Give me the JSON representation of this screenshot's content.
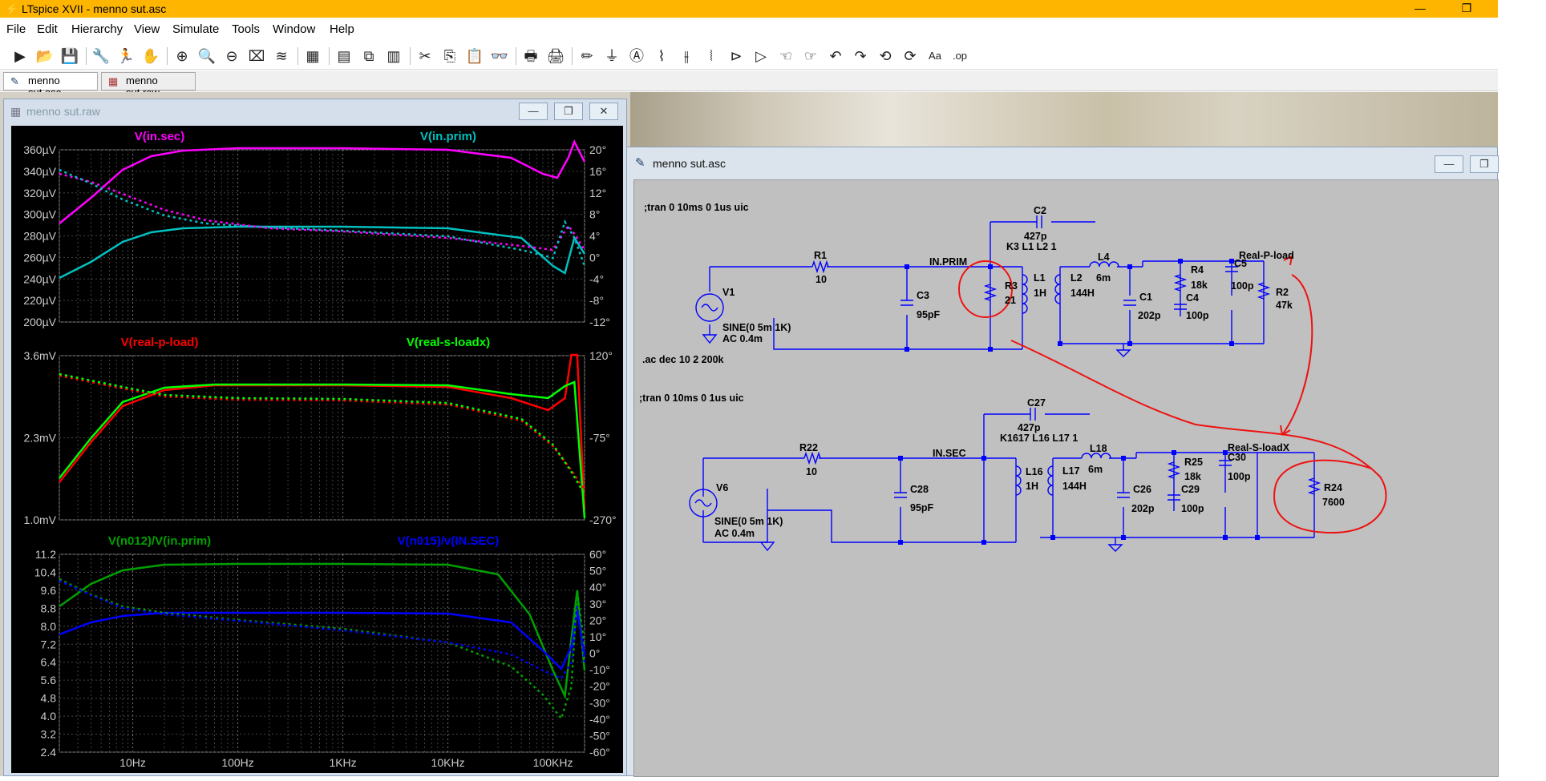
{
  "window": {
    "title": "LTspice XVII - menno sut.asc",
    "icon": "ltspice-icon",
    "controls": [
      "minimize",
      "restore"
    ]
  },
  "menu": [
    "File",
    "Edit",
    "Hierarchy",
    "View",
    "Simulate",
    "Tools",
    "Window",
    "Help"
  ],
  "toolbar_icons": [
    "run-icon",
    "open-icon",
    "save-icon",
    "settings-icon",
    "run-sim-icon",
    "pan-hand-icon",
    "zoom-in-icon",
    "zoom-area-icon",
    "zoom-out-icon",
    "zoom-fit-icon",
    "autoscale-icon",
    "grid-icon",
    "tile-horizontal-icon",
    "cascade-icon",
    "tile-vertical-icon",
    "cut-icon",
    "copy-icon",
    "paste-icon",
    "find-icon",
    "print-icon",
    "print-setup-icon",
    "draw-wire-icon",
    "ground-icon",
    "label-net-icon",
    "resistor-icon",
    "capacitor-icon",
    "inductor-icon",
    "diode-icon",
    "component-icon",
    "move-icon",
    "drag-icon",
    "undo-icon",
    "redo-icon",
    "rotate-icon",
    "mirror-icon",
    "text-icon",
    "spice-directive-icon"
  ],
  "tabs": [
    {
      "label": "menno sut.asc",
      "icon": "schematic-icon",
      "active": true
    },
    {
      "label": "menno sut.raw",
      "icon": "waveform-icon",
      "active": false
    }
  ],
  "plot_window": {
    "title": "menno sut.raw",
    "panes": [
      {
        "traces": [
          {
            "label": "V(in.sec)",
            "color": "#ff00ff"
          },
          {
            "label": "V(in.prim)",
            "color": "#00c0c0"
          }
        ],
        "left_ticks": [
          "360µV",
          "340µV",
          "320µV",
          "300µV",
          "280µV",
          "260µV",
          "240µV",
          "220µV",
          "200µV"
        ],
        "right_ticks": [
          "20°",
          "16°",
          "12°",
          "8°",
          "4°",
          "0°",
          "-4°",
          "-8°",
          "-12°"
        ]
      },
      {
        "traces": [
          {
            "label": "V(real-p-load)",
            "color": "#ff0000"
          },
          {
            "label": "V(real-s-loadx)",
            "color": "#00ff00"
          }
        ],
        "left_ticks": [
          "3.6mV",
          "2.3mV",
          "1.0mV"
        ],
        "right_ticks": [
          "120°",
          "-75°",
          "-270°"
        ]
      },
      {
        "traces": [
          {
            "label": "V(n012)/V(in.prim)",
            "color": "#00a000"
          },
          {
            "label": "V(n015)/v(IN.SEC)",
            "color": "#0000ff"
          }
        ],
        "left_ticks": [
          "11.2",
          "10.4",
          "9.6",
          "8.8",
          "8.0",
          "7.2",
          "6.4",
          "5.6",
          "4.8",
          "4.0",
          "3.2",
          "2.4"
        ],
        "right_ticks": [
          "60°",
          "50°",
          "40°",
          "30°",
          "20°",
          "10°",
          "0°",
          "-10°",
          "-20°",
          "-30°",
          "-40°",
          "-50°",
          "-60°"
        ]
      }
    ],
    "x_ticks": [
      "10Hz",
      "100Hz",
      "1KHz",
      "10KHz",
      "100KHz"
    ]
  },
  "schematic_window": {
    "title": "menno sut.asc",
    "directives": [
      ";tran 0 10ms 0 1us uic",
      ".ac dec 10 2 200k",
      ";tran 0 10ms 0 1us uic"
    ],
    "circuit_top": {
      "source": {
        "name": "V1",
        "value1": "SINE(0 5m 1K)",
        "value2": "AC 0.4m"
      },
      "R1": {
        "name": "R1",
        "value": "10"
      },
      "C3": {
        "name": "C3",
        "value": "95pF"
      },
      "net_prim": "IN.PRIM",
      "R3": {
        "name": "R3",
        "value": "21"
      },
      "L1": {
        "name": "L1",
        "value": "1H"
      },
      "C2": {
        "name": "C2",
        "value": "427p"
      },
      "coupling": "K3 L1 L2 1",
      "L2": {
        "name": "L2",
        "value": "144H"
      },
      "L4": {
        "name": "L4",
        "value": "6m"
      },
      "C1": {
        "name": "C1",
        "value": "202p"
      },
      "R4": {
        "name": "R4",
        "value": "18k"
      },
      "C4": {
        "name": "C4",
        "value": "100p"
      },
      "C5": {
        "name": "C5",
        "value": "100p"
      },
      "R2": {
        "name": "R2",
        "value": "47k"
      },
      "net_load": "Real-P-load"
    },
    "circuit_bottom": {
      "source": {
        "name": "V6",
        "value1": "SINE(0 5m 1K)",
        "value2": "AC 0.4m"
      },
      "R22": {
        "name": "R22",
        "value": "10"
      },
      "C28": {
        "name": "C28",
        "value": "95pF"
      },
      "net_sec": "IN.SEC",
      "L16": {
        "name": "L16",
        "value": "1H"
      },
      "C27": {
        "name": "C27",
        "value": "427p"
      },
      "coupling": "K1617 L16 L17 1",
      "L17": {
        "name": "L17",
        "value": "144H"
      },
      "L18": {
        "name": "L18",
        "value": "6m"
      },
      "C26": {
        "name": "C26",
        "value": "202p"
      },
      "R25": {
        "name": "R25",
        "value": "18k"
      },
      "C29": {
        "name": "C29",
        "value": "100p"
      },
      "C30": {
        "name": "C30",
        "value": "100p"
      },
      "R24": {
        "name": "R24",
        "value": "7600"
      },
      "net_load": "Real-S-loadX"
    }
  }
}
